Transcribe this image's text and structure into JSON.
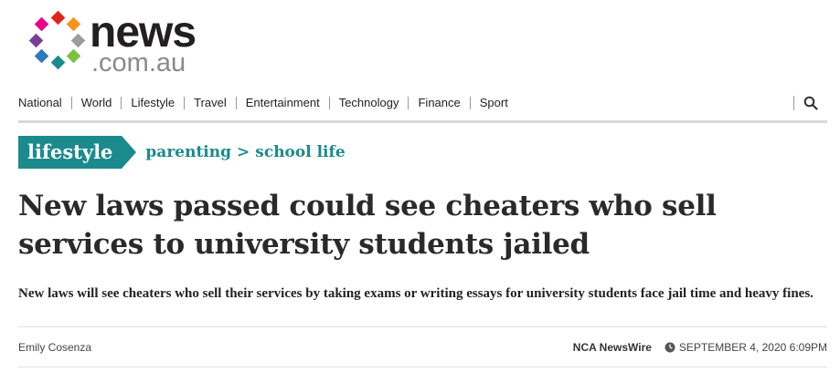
{
  "site": {
    "logo_word": "news",
    "logo_sub": ".com.au",
    "brand_colors": [
      "#e2231a",
      "#f7941d",
      "#7ac143",
      "#1b8a8d",
      "#8dc63f",
      "#2b7bb9",
      "#7b3f98",
      "#ec008c",
      "#9d9d9d"
    ]
  },
  "nav": {
    "items": [
      "National",
      "World",
      "Lifestyle",
      "Travel",
      "Entertainment",
      "Technology",
      "Finance",
      "Sport"
    ],
    "search_icon": "search-icon"
  },
  "section": {
    "tag": "lifestyle",
    "breadcrumbs": [
      "parenting",
      "school life"
    ],
    "separator": ">",
    "accent": "#1b8a8d"
  },
  "article": {
    "headline": "New laws passed could see cheaters who sell services to university students jailed",
    "standfirst": "New laws will see cheaters who sell their services by taking exams or writing essays for university students face jail time and heavy fines.",
    "author": "Emily Cosenza",
    "source": "NCA NewsWire",
    "timestamp": "SEPTEMBER 4, 2020 6:09PM",
    "clock_icon": "clock-icon"
  }
}
